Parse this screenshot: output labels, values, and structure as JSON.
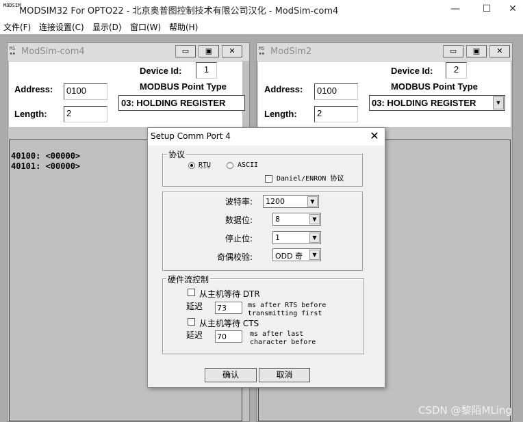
{
  "app": {
    "icon_text": "MODSIM",
    "title": "MODSIM32 For OPTO22 - 北京奥普图控制技术有限公司汉化 - ModSim-com4",
    "minimize_glyph": "—",
    "maximize_glyph": "☐",
    "close_glyph": "✕"
  },
  "menu": [
    {
      "label": "文件(F)"
    },
    {
      "label": "连接设置(C)"
    },
    {
      "label": "显示(D)"
    },
    {
      "label": "窗口(W)"
    },
    {
      "label": "帮助(H)"
    }
  ],
  "windows": [
    {
      "title": "ModSim-com4",
      "device_id_label": "Device Id:",
      "device_id": "1",
      "address_label": "Address:",
      "address": "0100",
      "length_label": "Length:",
      "length": "2",
      "point_type_label": "MODBUS Point Type",
      "point_type": "03: HOLDING REGISTER",
      "registers": [
        "40100: <00000>",
        "40101: <00000>"
      ]
    },
    {
      "title": "ModSim2",
      "device_id_label": "Device Id:",
      "device_id": "2",
      "address_label": "Address:",
      "address": "0100",
      "length_label": "Length:",
      "length": "2",
      "point_type_label": "MODBUS Point Type",
      "point_type": "03: HOLDING REGISTER"
    }
  ],
  "child_buttons": {
    "min": "▭",
    "max": "▣",
    "close": "✕"
  },
  "dialog": {
    "title": "Setup Comm Port 4",
    "close_glyph": "✕",
    "protocol": {
      "legend": "协议",
      "rtu": "RTU",
      "ascii": "ASCII",
      "selected": "RTU",
      "daniel": "Daniel/ENRON 协议"
    },
    "params": {
      "baud_label": "波特率:",
      "baud_value": "1200",
      "data_bits_label": "数据位:",
      "data_bits_value": "8",
      "stop_bits_label": "停止位:",
      "stop_bits_value": "1",
      "parity_label": "奇偶校验:",
      "parity_value": "ODD 奇"
    },
    "flow": {
      "legend": "硬件流控制",
      "dtr_label": "从主机等待 DTR",
      "delay_label_1": "延迟",
      "delay_1": "73",
      "delay_1_note_a": "ms after RTS before",
      "delay_1_note_b": "transmitting first",
      "cts_label": "从主机等待 CTS",
      "delay_label_2": "延迟",
      "delay_2": "70",
      "delay_2_note_a": "ms after last",
      "delay_2_note_b": "character before"
    },
    "ok": "确认",
    "cancel": "取消"
  },
  "watermark": "CSDN @黎陌MLing"
}
